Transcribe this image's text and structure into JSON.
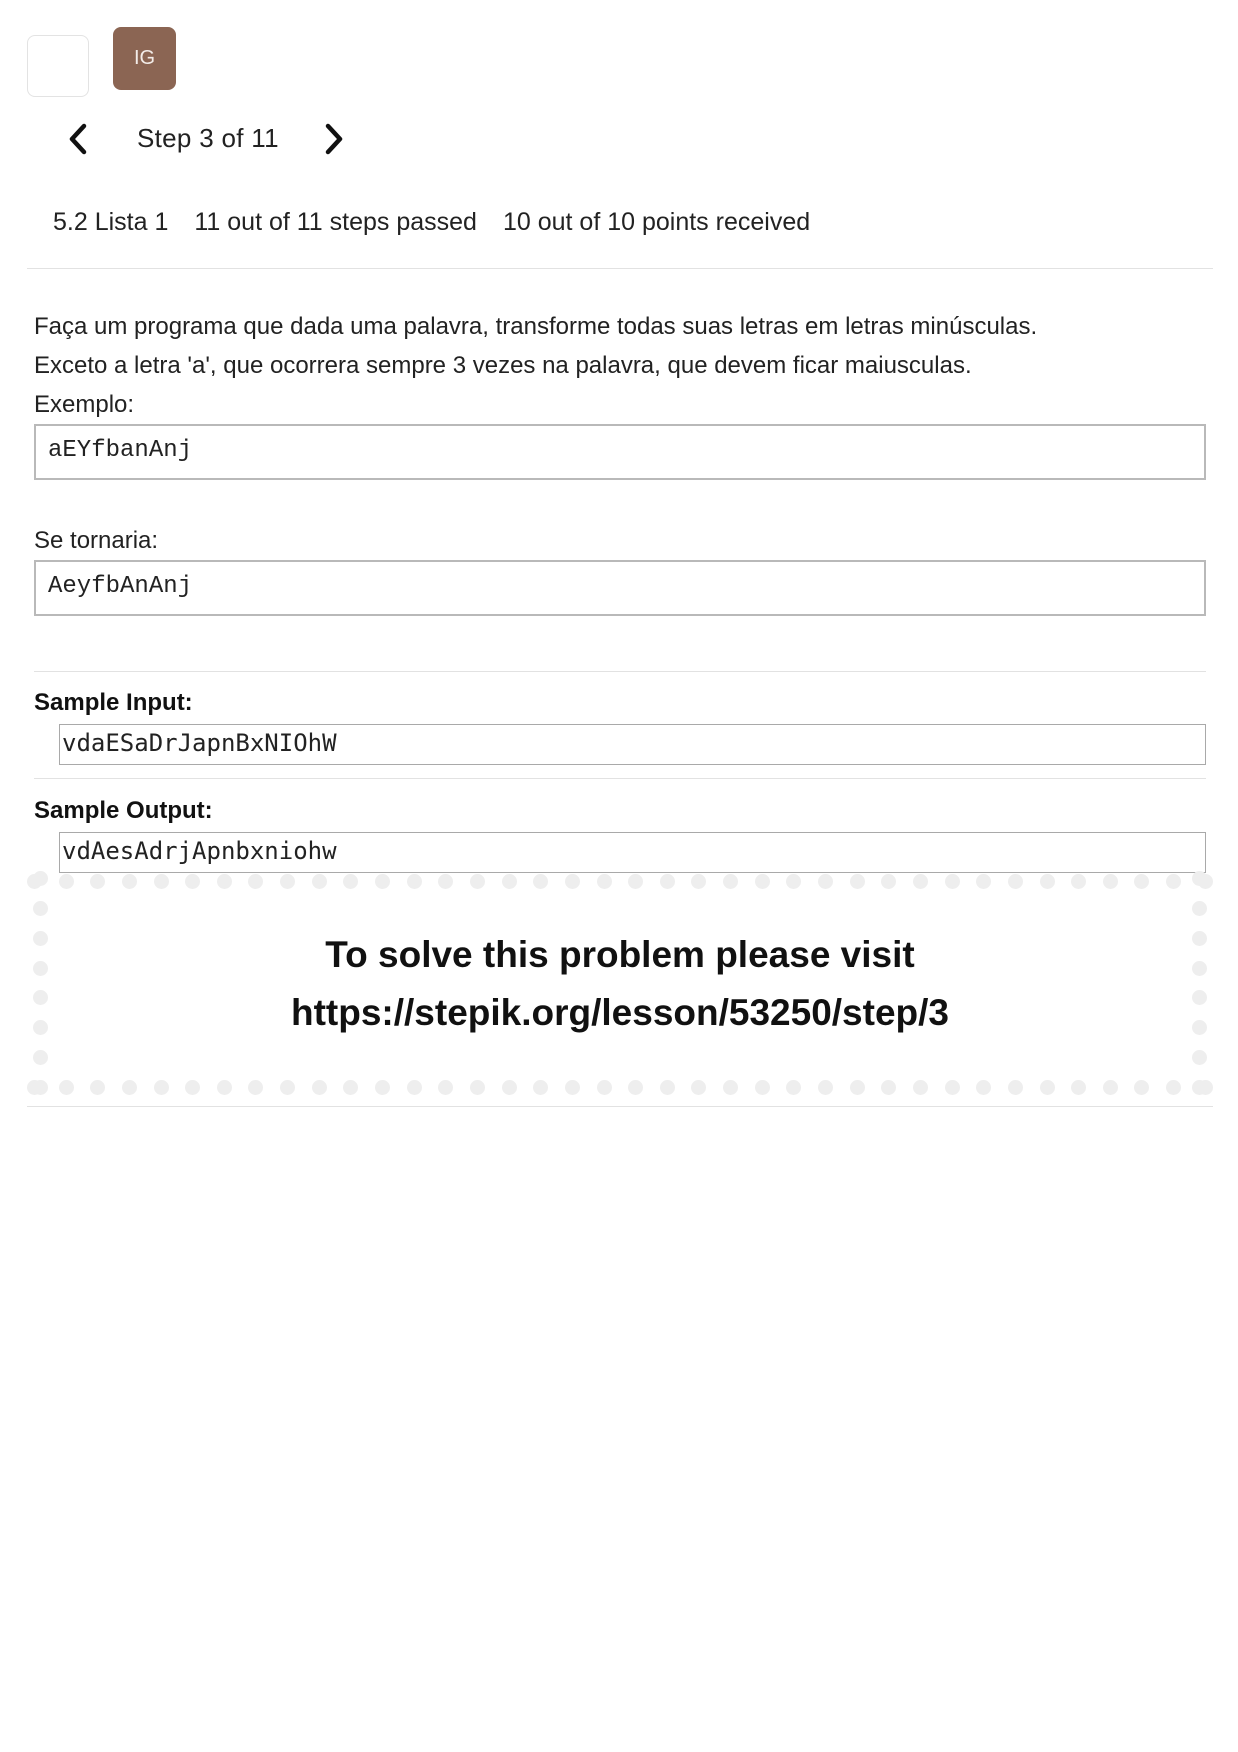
{
  "header": {
    "avatar_initials": "IG",
    "step_counter": "Step 3 of 11",
    "icons": {
      "prev": "chevron-left-icon",
      "next": "chevron-right-icon"
    }
  },
  "lesson": {
    "title": "5.2 Lista 1",
    "steps_status": "11 out of 11 steps passed",
    "points_status": "10 out of 10 points received"
  },
  "problem": {
    "line1": "Faça um programa que dada uma palavra, transforme todas suas letras em letras minúsculas.",
    "line2": "Exceto a letra 'a', que ocorrera sempre 3 vezes na palavra, que devem ficar maiusculas.",
    "example_label": "Exemplo:",
    "example_value": "aEYfbanAnj",
    "result_label": "Se tornaria:",
    "result_value": "AeyfbAnAnj"
  },
  "samples": {
    "input_label": "Sample Input:",
    "input_value": "vdaESaDrJapnBxNIOhW",
    "output_label": "Sample Output:",
    "output_value": "vdAesAdrjApnbxniohw"
  },
  "visit": {
    "line1": "To solve this problem please visit",
    "line2": "https://stepik.org/lesson/53250/step/3"
  },
  "colors": {
    "avatar_bg": "#8b6553",
    "divider": "#e2e2e2",
    "dots": "#eeeeee"
  }
}
